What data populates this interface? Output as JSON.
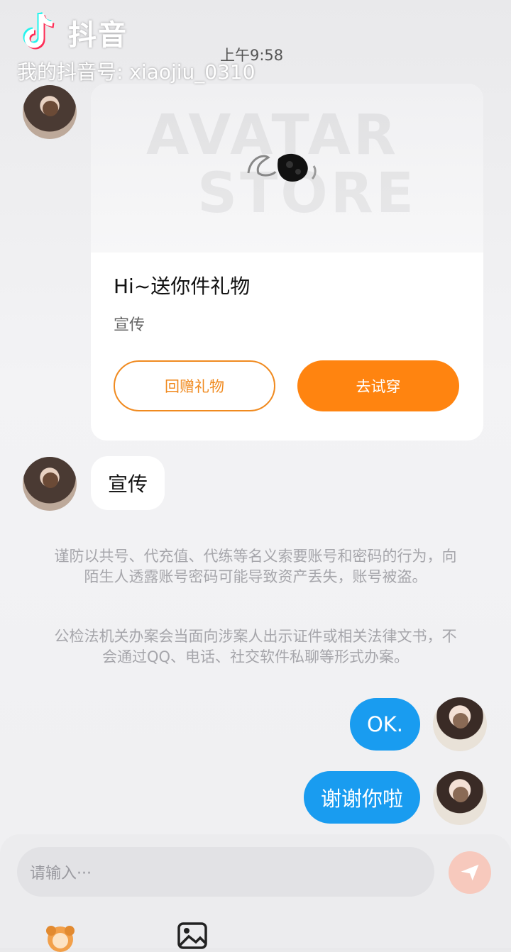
{
  "watermark": {
    "brand": "抖音",
    "account": "我的抖音号: xiaojiu_0310"
  },
  "status": {
    "time": "上午9:58"
  },
  "gift_card": {
    "image_text_line1": "AVATAR",
    "image_text_line2": "STORE",
    "title": "Hi~送你件礼物",
    "subtitle": "宣传",
    "return_gift_label": "回赠礼物",
    "try_on_label": "去试穿"
  },
  "messages": {
    "incoming_text": "宣传",
    "outgoing_1": "OK.",
    "outgoing_2": "谢谢你啦"
  },
  "notice": {
    "paragraph_1": "谨防以共号、代充值、代练等名义索要账号和密码的行为，向陌生人透露账号密码可能导致资产丢失，账号被盗。",
    "paragraph_2": "公检法机关办案会当面向涉案人出示证件或相关法律文书，不会通过QQ、电话、社交软件私聊等形式办案。"
  },
  "input": {
    "placeholder": "请输入···"
  },
  "colors": {
    "accent_orange": "#ff8410",
    "bubble_blue": "#199cf0"
  }
}
